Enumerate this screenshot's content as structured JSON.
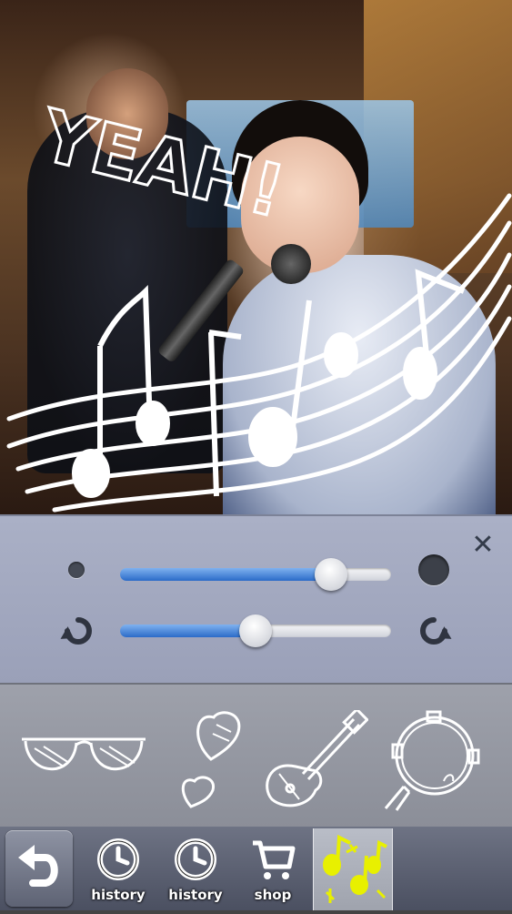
{
  "photo": {
    "doodle_text": "YEAH!"
  },
  "controls": {
    "close_label": "✕",
    "size_slider": {
      "value": 0.78
    },
    "rotation_slider": {
      "value": 0.5
    }
  },
  "stickers": [
    "sunglasses-icon",
    "hearts-icon",
    "guitar-icon",
    "tambourine-icon"
  ],
  "toolbar": {
    "tabs": [
      {
        "icon": "history-icon",
        "label": "history"
      },
      {
        "icon": "history-icon",
        "label": "history"
      },
      {
        "icon": "cart-icon",
        "label": "shop"
      },
      {
        "icon": "music-notes-icon",
        "label": ""
      }
    ]
  },
  "colors": {
    "accent_blue": "#2b6bc8",
    "selected_highlight": "#e8f000"
  }
}
